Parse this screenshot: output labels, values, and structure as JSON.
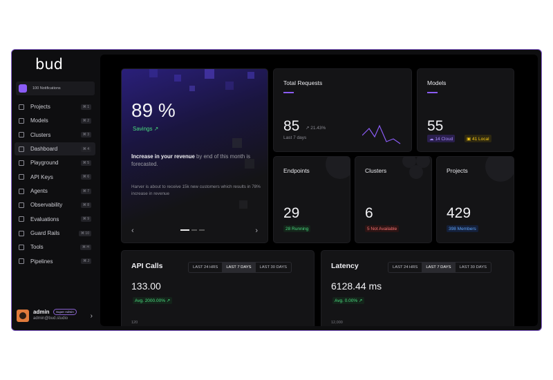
{
  "brand": {
    "logo_text": "bud"
  },
  "notifications": {
    "label": "100 Notifications"
  },
  "sidebar": {
    "items": [
      {
        "label": "Projects",
        "shortcut": "⌘ 1",
        "icon": "projects-icon"
      },
      {
        "label": "Models",
        "shortcut": "⌘ 2",
        "icon": "models-icon"
      },
      {
        "label": "Clusters",
        "shortcut": "⌘ 3",
        "icon": "clusters-icon"
      },
      {
        "label": "Dashboard",
        "shortcut": "⌘ 4",
        "icon": "dashboard-icon",
        "active": true
      },
      {
        "label": "Playground",
        "shortcut": "⌘ 5",
        "icon": "playground-icon"
      },
      {
        "label": "API Keys",
        "shortcut": "⌘ 6",
        "icon": "key-icon"
      },
      {
        "label": "Agents",
        "shortcut": "⌘ 7",
        "icon": "agents-icon"
      },
      {
        "label": "Observability",
        "shortcut": "⌘ 8",
        "icon": "observability-icon"
      },
      {
        "label": "Evaluations",
        "shortcut": "⌘ 9",
        "icon": "evaluations-icon"
      },
      {
        "label": "Guard Rails",
        "shortcut": "⌘ 10",
        "icon": "guard-rails-icon"
      },
      {
        "label": "Tools",
        "shortcut": "⌘ H",
        "icon": "tools-icon"
      },
      {
        "label": "Pipelines",
        "shortcut": "⌘ J",
        "icon": "pipelines-icon"
      }
    ]
  },
  "user": {
    "name": "admin",
    "role": "Super Admin",
    "email": "admin@bud.studio"
  },
  "hero": {
    "value": "89 %",
    "trend": "Savings ↗",
    "headline_bold": "Increase in your revenue",
    "headline_rest": " by end of this month is forecasted.",
    "description": "Harver is about to receive 15k new customers which results in 78% increase in revenue"
  },
  "total_requests": {
    "title": "Total Requests",
    "value": "85",
    "change": "↗ 21.43%",
    "period": "Last 7 days"
  },
  "models": {
    "title": "Models",
    "value": "55",
    "cloud": "14 Cloud",
    "local": "41 Local"
  },
  "endpoints": {
    "title": "Endpoints",
    "value": "29",
    "status": "28 Running"
  },
  "clusters": {
    "title": "Clusters",
    "value": "6",
    "status": "5 Not Available"
  },
  "projects": {
    "title": "Projects",
    "value": "429",
    "status": "398 Members"
  },
  "api_calls": {
    "title": "API Calls",
    "ranges": [
      "LAST 24 HRS",
      "LAST 7 DAYS",
      "LAST 30 DAYS"
    ],
    "selected": "LAST 7 DAYS",
    "value": "133.00",
    "avg": "Avg. 2000.00% ↗",
    "axis_top": "120"
  },
  "latency": {
    "title": "Latency",
    "ranges": [
      "LAST 24 HRS",
      "LAST 7 DAYS",
      "LAST 30 DAYS"
    ],
    "selected": "LAST 7 DAYS",
    "value": "6128.44 ms",
    "avg": "Avg. 0.00% ↗",
    "axis_top": "12,000"
  },
  "colors": {
    "accent": "#8b5cf6",
    "positive": "#4ade80",
    "negative": "#f87171",
    "info": "#60a5fa",
    "warning": "#facc15"
  }
}
